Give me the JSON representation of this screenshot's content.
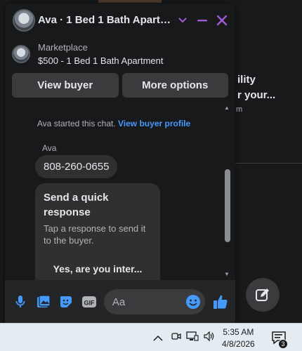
{
  "background": {
    "line1": "ility",
    "line2": "r your...",
    "line3": "m"
  },
  "chat": {
    "title": "Ava · 1 Bed 1 Bath Apartm…",
    "icons": {
      "dropdown": "chevron-down-icon",
      "minimize": "minimize-icon",
      "close": "close-icon"
    },
    "accent_color": "#a25ad8"
  },
  "listing": {
    "label": "Marketplace",
    "title": "$500 - 1 Bed 1 Bath Apartment"
  },
  "actions": {
    "view_buyer": "View buyer",
    "more_options": "More options"
  },
  "messages": {
    "system_prefix": "Ava started this chat.",
    "system_link": "View buyer profile",
    "sender": "Ava",
    "phone": "808-260-0655",
    "quick_title": "Send a quick response",
    "quick_desc": "Tap a response to send it to the buyer.",
    "quick_reply": "Yes, are you inter..."
  },
  "composer": {
    "placeholder": "Aa",
    "icons": [
      "microphone-icon",
      "photo-icon",
      "sticker-icon",
      "gif-icon",
      "emoji-icon",
      "like-icon"
    ],
    "gif_label": "GIF",
    "link_color": "#4599ff"
  },
  "taskbar": {
    "time": "5:35 AM",
    "date": "4/8/2026",
    "notification_count": "3"
  }
}
